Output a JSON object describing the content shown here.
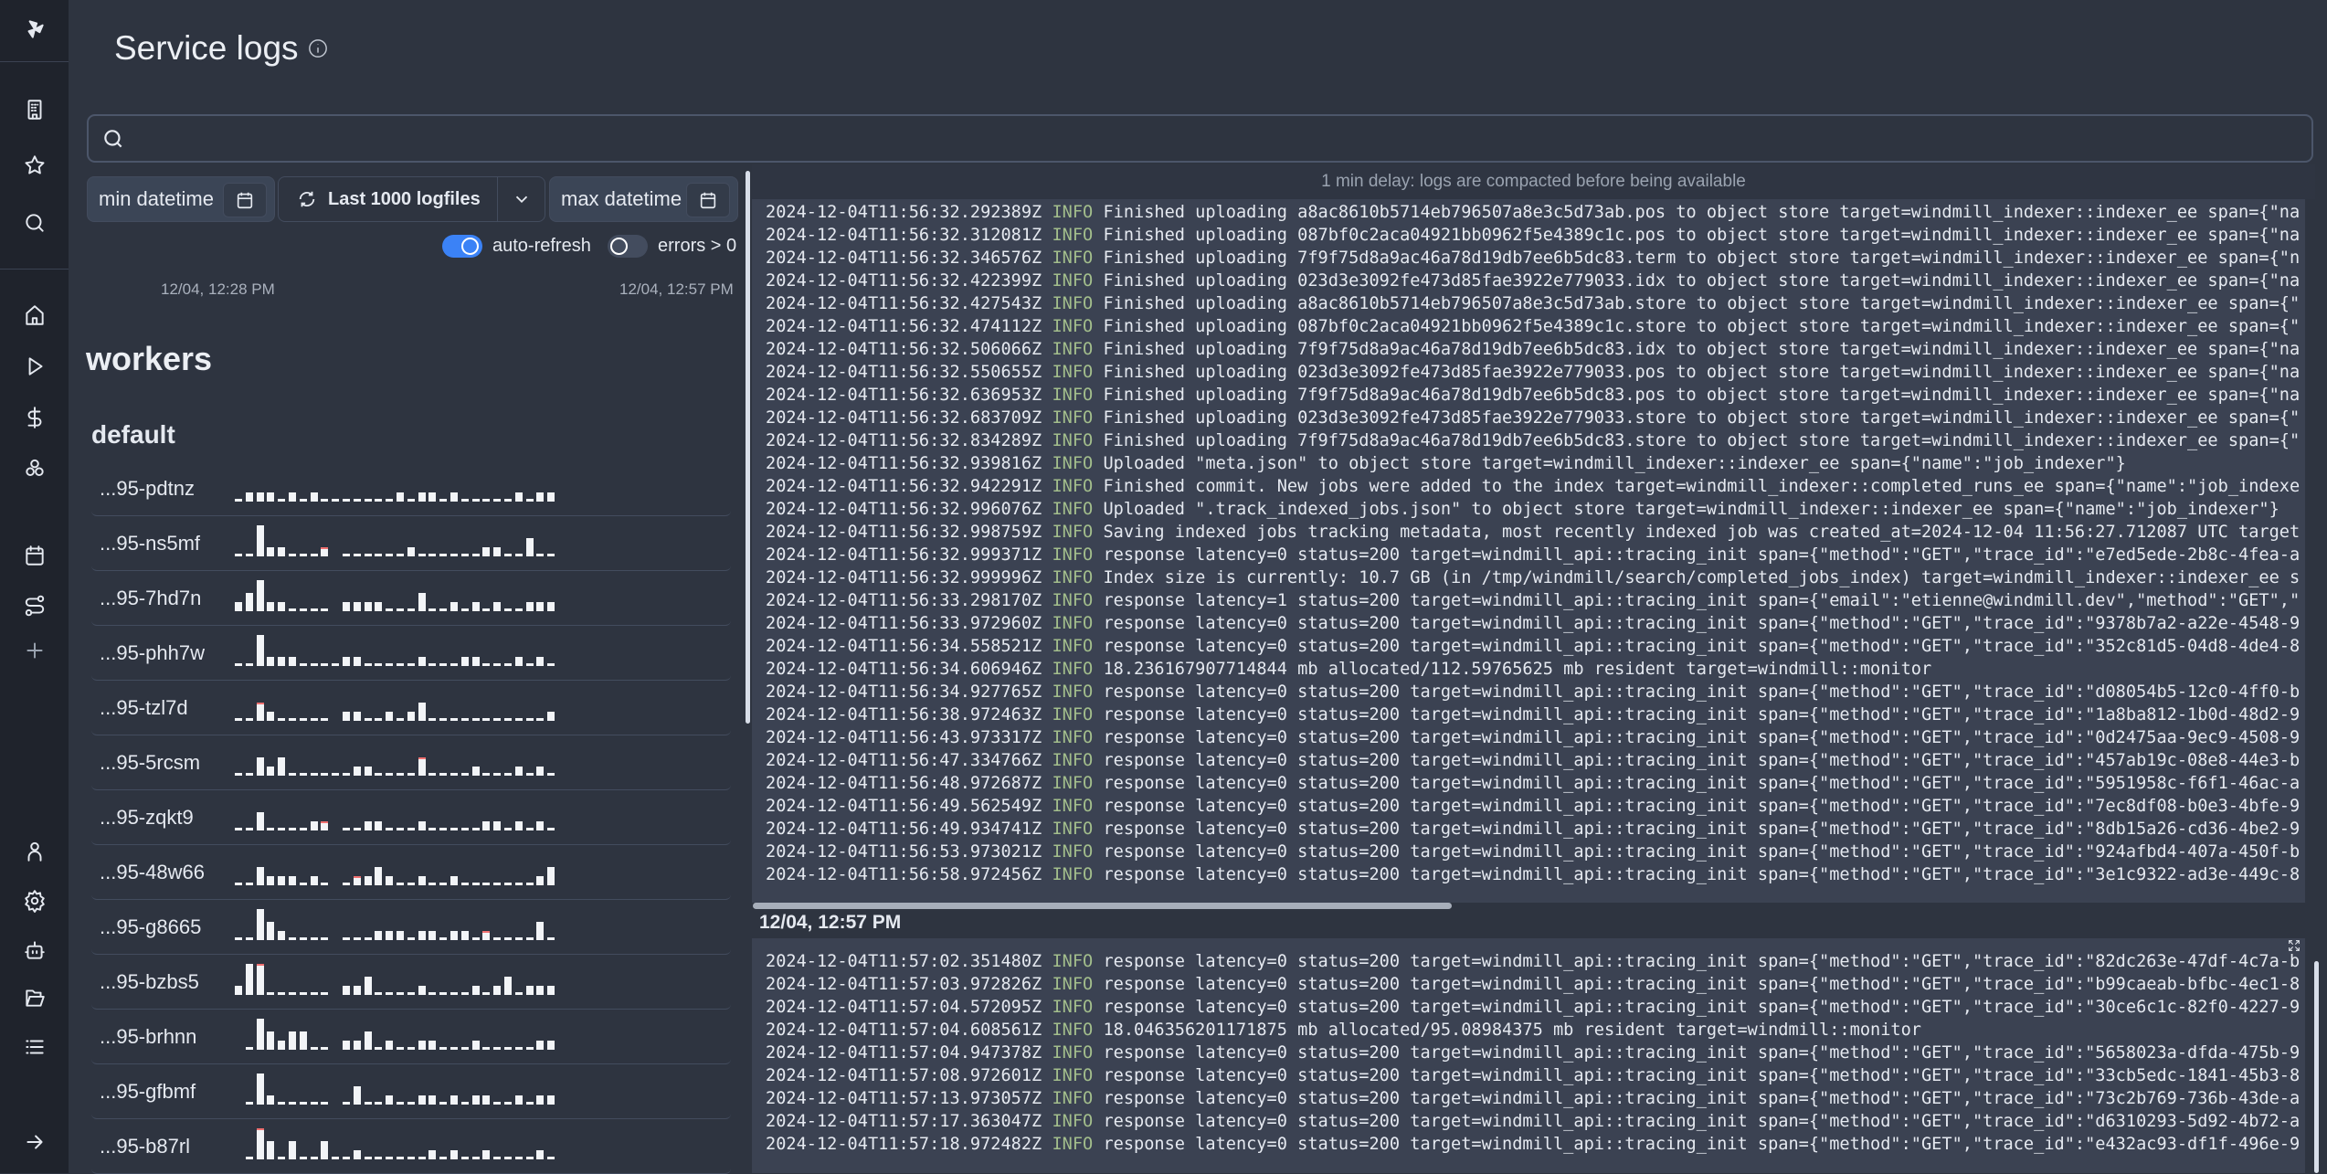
{
  "page": {
    "title": "Service logs",
    "info_icon": "info-icon"
  },
  "sidebar": {
    "items": [
      {
        "name": "logo",
        "icon": "windmill-logo"
      },
      {
        "name": "workspace",
        "icon": "building-icon"
      },
      {
        "name": "favorites",
        "icon": "star-icon"
      },
      {
        "name": "search",
        "icon": "search-icon"
      },
      {
        "name": "home",
        "icon": "home-icon"
      },
      {
        "name": "runs",
        "icon": "play-icon"
      },
      {
        "name": "variables",
        "icon": "dollar-icon"
      },
      {
        "name": "resources",
        "icon": "boxes-icon"
      },
      {
        "name": "schedules",
        "icon": "calendar-icon"
      },
      {
        "name": "flows",
        "icon": "route-icon"
      },
      {
        "name": "add",
        "icon": "plus-icon"
      },
      {
        "name": "user",
        "icon": "user-icon"
      },
      {
        "name": "settings",
        "icon": "gear-icon"
      },
      {
        "name": "workers",
        "icon": "bot-icon"
      },
      {
        "name": "folders",
        "icon": "folder-open-icon"
      },
      {
        "name": "logs",
        "icon": "list-icon"
      },
      {
        "name": "expand",
        "icon": "arrow-right-icon"
      }
    ]
  },
  "search": {
    "value": "",
    "placeholder": ""
  },
  "filters": {
    "min_datetime": "min datetime",
    "logfiles": "Last 1000 logfiles",
    "max_datetime": "max datetime",
    "auto_refresh": {
      "label": "auto-refresh",
      "on": true
    },
    "errors": {
      "label": "errors > 0",
      "on": false
    }
  },
  "timeline": {
    "start": "12/04, 12:28 PM",
    "end": "12/04, 12:57 PM"
  },
  "workers": {
    "heading": "workers",
    "group": "default",
    "items": [
      {
        "name": "...95-pdtnz",
        "bars": [
          0,
          1,
          1,
          1,
          0,
          1,
          0,
          1,
          0,
          0,
          0,
          0,
          0,
          0,
          0,
          1,
          0,
          1,
          1,
          0,
          1,
          0,
          0,
          0,
          0,
          0,
          1,
          0,
          1,
          1
        ],
        "errors": []
      },
      {
        "name": "...95-ns5mf",
        "bars": [
          0,
          0,
          3,
          1,
          1,
          0,
          0,
          0,
          1,
          null,
          0,
          0,
          0,
          0,
          0,
          0,
          1,
          0,
          0,
          0,
          0,
          0,
          0,
          1,
          1,
          0,
          0,
          2,
          0,
          0
        ],
        "errors": [
          8
        ]
      },
      {
        "name": "...95-7hd7n",
        "bars": [
          1,
          2,
          3,
          1,
          1,
          0,
          0,
          0,
          0,
          null,
          1,
          1,
          1,
          1,
          0,
          0,
          0,
          2,
          0,
          0,
          1,
          0,
          1,
          0,
          1,
          0,
          0,
          1,
          1,
          1
        ],
        "errors": []
      },
      {
        "name": "...95-phh7w",
        "bars": [
          0,
          0,
          3,
          1,
          1,
          1,
          0,
          0,
          0,
          0,
          1,
          1,
          0,
          0,
          0,
          0,
          0,
          1,
          0,
          0,
          0,
          1,
          1,
          0,
          0,
          0,
          1,
          0,
          1,
          0
        ],
        "errors": []
      },
      {
        "name": "...95-tzl7d",
        "bars": [
          0,
          0,
          2,
          1,
          0,
          0,
          0,
          0,
          0,
          null,
          1,
          1,
          0,
          0,
          1,
          0,
          1,
          2,
          0,
          0,
          0,
          0,
          0,
          0,
          0,
          0,
          0,
          0,
          0,
          1
        ],
        "errors": [
          2
        ]
      },
      {
        "name": "...95-5rcsm",
        "bars": [
          0,
          0,
          2,
          1,
          2,
          0,
          0,
          0,
          0,
          0,
          0,
          1,
          1,
          0,
          0,
          0,
          0,
          2,
          0,
          0,
          0,
          0,
          1,
          0,
          0,
          0,
          1,
          0,
          1,
          0
        ],
        "errors": [
          17
        ]
      },
      {
        "name": "...95-zqkt9",
        "bars": [
          0,
          0,
          2,
          0,
          0,
          0,
          0,
          1,
          1,
          null,
          0,
          0,
          1,
          1,
          0,
          0,
          0,
          1,
          0,
          0,
          0,
          0,
          0,
          1,
          1,
          0,
          1,
          0,
          1,
          0
        ],
        "errors": [
          8
        ]
      },
      {
        "name": "...95-48w66",
        "bars": [
          0,
          0,
          2,
          1,
          1,
          1,
          0,
          1,
          0,
          null,
          0,
          1,
          1,
          2,
          1,
          0,
          0,
          1,
          0,
          0,
          1,
          0,
          0,
          0,
          0,
          0,
          0,
          0,
          1,
          2
        ],
        "errors": [
          11
        ]
      },
      {
        "name": "...95-g8665",
        "bars": [
          0,
          0,
          3,
          2,
          1,
          0,
          0,
          0,
          0,
          null,
          0,
          0,
          0,
          1,
          1,
          1,
          0,
          1,
          1,
          0,
          1,
          1,
          0,
          1,
          0,
          0,
          0,
          0,
          2,
          0
        ],
        "errors": [
          23
        ]
      },
      {
        "name": "...95-bzbs5",
        "bars": [
          1,
          3,
          3,
          0,
          0,
          0,
          0,
          0,
          0,
          null,
          1,
          1,
          2,
          0,
          0,
          0,
          0,
          1,
          0,
          0,
          0,
          0,
          1,
          0,
          1,
          2,
          0,
          1,
          1,
          1
        ],
        "errors": [
          2
        ]
      },
      {
        "name": "...95-brhnn",
        "bars": [
          null,
          0,
          3,
          2,
          1,
          2,
          2,
          0,
          0,
          null,
          1,
          1,
          2,
          0,
          1,
          0,
          0,
          1,
          1,
          0,
          0,
          0,
          1,
          0,
          0,
          0,
          0,
          0,
          1,
          1
        ],
        "errors": []
      },
      {
        "name": "...95-gfbmf",
        "bars": [
          null,
          0,
          3,
          1,
          0,
          0,
          0,
          0,
          0,
          null,
          0,
          2,
          0,
          0,
          1,
          0,
          0,
          1,
          1,
          0,
          1,
          0,
          1,
          1,
          0,
          0,
          1,
          0,
          1,
          1
        ],
        "errors": []
      },
      {
        "name": "...95-b87rl",
        "bars": [
          null,
          0,
          3,
          2,
          0,
          2,
          0,
          0,
          2,
          0,
          0,
          1,
          0,
          0,
          0,
          0,
          0,
          0,
          1,
          0,
          1,
          0,
          0,
          1,
          0,
          0,
          0,
          0,
          1,
          0
        ],
        "errors": [
          2
        ]
      }
    ]
  },
  "logs": {
    "notice": "1 min delay: logs are compacted before being available",
    "upper": [
      {
        "ts": "2024-12-04T11:56:32.292389Z",
        "level": "INFO",
        "msg": "Finished uploading a8ac8610b5714eb796507a8e3c5d73ab.pos to object store target=windmill_indexer::indexer_ee span={\"na"
      },
      {
        "ts": "2024-12-04T11:56:32.312081Z",
        "level": "INFO",
        "msg": "Finished uploading 087bf0c2aca04921bb0962f5e4389c1c.pos to object store target=windmill_indexer::indexer_ee span={\"na"
      },
      {
        "ts": "2024-12-04T11:56:32.346576Z",
        "level": "INFO",
        "msg": "Finished uploading 7f9f75d8a9ac46a78d19db7ee6b5dc83.term to object store target=windmill_indexer::indexer_ee span={\"n"
      },
      {
        "ts": "2024-12-04T11:56:32.422399Z",
        "level": "INFO",
        "msg": "Finished uploading 023d3e3092fe473d85fae3922e779033.idx to object store target=windmill_indexer::indexer_ee span={\"na"
      },
      {
        "ts": "2024-12-04T11:56:32.427543Z",
        "level": "INFO",
        "msg": "Finished uploading a8ac8610b5714eb796507a8e3c5d73ab.store to object store target=windmill_indexer::indexer_ee span={\""
      },
      {
        "ts": "2024-12-04T11:56:32.474112Z",
        "level": "INFO",
        "msg": "Finished uploading 087bf0c2aca04921bb0962f5e4389c1c.store to object store target=windmill_indexer::indexer_ee span={\""
      },
      {
        "ts": "2024-12-04T11:56:32.506066Z",
        "level": "INFO",
        "msg": "Finished uploading 7f9f75d8a9ac46a78d19db7ee6b5dc83.idx to object store target=windmill_indexer::indexer_ee span={\"na"
      },
      {
        "ts": "2024-12-04T11:56:32.550655Z",
        "level": "INFO",
        "msg": "Finished uploading 023d3e3092fe473d85fae3922e779033.pos to object store target=windmill_indexer::indexer_ee span={\"na"
      },
      {
        "ts": "2024-12-04T11:56:32.636953Z",
        "level": "INFO",
        "msg": "Finished uploading 7f9f75d8a9ac46a78d19db7ee6b5dc83.pos to object store target=windmill_indexer::indexer_ee span={\"na"
      },
      {
        "ts": "2024-12-04T11:56:32.683709Z",
        "level": "INFO",
        "msg": "Finished uploading 023d3e3092fe473d85fae3922e779033.store to object store target=windmill_indexer::indexer_ee span={\""
      },
      {
        "ts": "2024-12-04T11:56:32.834289Z",
        "level": "INFO",
        "msg": "Finished uploading 7f9f75d8a9ac46a78d19db7ee6b5dc83.store to object store target=windmill_indexer::indexer_ee span={\""
      },
      {
        "ts": "2024-12-04T11:56:32.939816Z",
        "level": "INFO",
        "msg": "Uploaded \"meta.json\" to object store target=windmill_indexer::indexer_ee span={\"name\":\"job_indexer\"}"
      },
      {
        "ts": "2024-12-04T11:56:32.942291Z",
        "level": "INFO",
        "msg": "Finished commit. New jobs were added to the index target=windmill_indexer::completed_runs_ee span={\"name\":\"job_indexe"
      },
      {
        "ts": "2024-12-04T11:56:32.996076Z",
        "level": "INFO",
        "msg": "Uploaded \".track_indexed_jobs.json\" to object store target=windmill_indexer::indexer_ee span={\"name\":\"job_indexer\"}"
      },
      {
        "ts": "2024-12-04T11:56:32.998759Z",
        "level": "INFO",
        "msg": "Saving indexed jobs tracking metadata, most recently indexed job was created_at=2024-12-04 11:56:27.712087 UTC target"
      },
      {
        "ts": "2024-12-04T11:56:32.999371Z",
        "level": "INFO",
        "msg": "response latency=0 status=200 target=windmill_api::tracing_init span={\"method\":\"GET\",\"trace_id\":\"e7ed5ede-2b8c-4fea-a"
      },
      {
        "ts": "2024-12-04T11:56:32.999996Z",
        "level": "INFO",
        "msg": "Index size is currently: 10.7 GB (in /tmp/windmill/search/completed_jobs_index) target=windmill_indexer::indexer_ee s"
      },
      {
        "ts": "2024-12-04T11:56:33.298170Z",
        "level": "INFO",
        "msg": "response latency=1 status=200 target=windmill_api::tracing_init span={\"email\":\"etienne@windmill.dev\",\"method\":\"GET\",\""
      },
      {
        "ts": "2024-12-04T11:56:33.972960Z",
        "level": "INFO",
        "msg": "response latency=0 status=200 target=windmill_api::tracing_init span={\"method\":\"GET\",\"trace_id\":\"9378b7a2-a22e-4548-9"
      },
      {
        "ts": "2024-12-04T11:56:34.558521Z",
        "level": "INFO",
        "msg": "response latency=0 status=200 target=windmill_api::tracing_init span={\"method\":\"GET\",\"trace_id\":\"352c81d5-04d8-4de4-8"
      },
      {
        "ts": "2024-12-04T11:56:34.606946Z",
        "level": "INFO",
        "msg": "18.236167907714844 mb allocated/112.59765625 mb resident target=windmill::monitor"
      },
      {
        "ts": "2024-12-04T11:56:34.927765Z",
        "level": "INFO",
        "msg": "response latency=0 status=200 target=windmill_api::tracing_init span={\"method\":\"GET\",\"trace_id\":\"d08054b5-12c0-4ff0-b"
      },
      {
        "ts": "2024-12-04T11:56:38.972463Z",
        "level": "INFO",
        "msg": "response latency=0 status=200 target=windmill_api::tracing_init span={\"method\":\"GET\",\"trace_id\":\"1a8ba812-1b0d-48d2-9"
      },
      {
        "ts": "2024-12-04T11:56:43.973317Z",
        "level": "INFO",
        "msg": "response latency=0 status=200 target=windmill_api::tracing_init span={\"method\":\"GET\",\"trace_id\":\"0d2475aa-9ec9-4508-9"
      },
      {
        "ts": "2024-12-04T11:56:47.334766Z",
        "level": "INFO",
        "msg": "response latency=0 status=200 target=windmill_api::tracing_init span={\"method\":\"GET\",\"trace_id\":\"457ab19c-08e8-44e3-b"
      },
      {
        "ts": "2024-12-04T11:56:48.972687Z",
        "level": "INFO",
        "msg": "response latency=0 status=200 target=windmill_api::tracing_init span={\"method\":\"GET\",\"trace_id\":\"5951958c-f6f1-46ac-a"
      },
      {
        "ts": "2024-12-04T11:56:49.562549Z",
        "level": "INFO",
        "msg": "response latency=0 status=200 target=windmill_api::tracing_init span={\"method\":\"GET\",\"trace_id\":\"7ec8df08-b0e3-4bfe-9"
      },
      {
        "ts": "2024-12-04T11:56:49.934741Z",
        "level": "INFO",
        "msg": "response latency=0 status=200 target=windmill_api::tracing_init span={\"method\":\"GET\",\"trace_id\":\"8db15a26-cd36-4be2-9"
      },
      {
        "ts": "2024-12-04T11:56:53.973021Z",
        "level": "INFO",
        "msg": "response latency=0 status=200 target=windmill_api::tracing_init span={\"method\":\"GET\",\"trace_id\":\"924afbd4-407a-450f-b"
      },
      {
        "ts": "2024-12-04T11:56:58.972456Z",
        "level": "INFO",
        "msg": "response latency=0 status=200 target=windmill_api::tracing_init span={\"method\":\"GET\",\"trace_id\":\"3e1c9322-ad3e-449c-8"
      }
    ],
    "section_header": "12/04, 12:57 PM",
    "lower": [
      {
        "ts": "2024-12-04T11:57:02.351480Z",
        "level": "INFO",
        "msg": "response latency=0 status=200 target=windmill_api::tracing_init span={\"method\":\"GET\",\"trace_id\":\"82dc263e-47df-4c7a-b"
      },
      {
        "ts": "2024-12-04T11:57:03.972826Z",
        "level": "INFO",
        "msg": "response latency=0 status=200 target=windmill_api::tracing_init span={\"method\":\"GET\",\"trace_id\":\"b99caeab-bfbc-4ec1-8"
      },
      {
        "ts": "2024-12-04T11:57:04.572095Z",
        "level": "INFO",
        "msg": "response latency=0 status=200 target=windmill_api::tracing_init span={\"method\":\"GET\",\"trace_id\":\"30ce6c1c-82f0-4227-9"
      },
      {
        "ts": "2024-12-04T11:57:04.608561Z",
        "level": "INFO",
        "msg": "18.046356201171875 mb allocated/95.08984375 mb resident target=windmill::monitor"
      },
      {
        "ts": "2024-12-04T11:57:04.947378Z",
        "level": "INFO",
        "msg": "response latency=0 status=200 target=windmill_api::tracing_init span={\"method\":\"GET\",\"trace_id\":\"5658023a-dfda-475b-9"
      },
      {
        "ts": "2024-12-04T11:57:08.972601Z",
        "level": "INFO",
        "msg": "response latency=0 status=200 target=windmill_api::tracing_init span={\"method\":\"GET\",\"trace_id\":\"33cb5edc-1841-45b3-8"
      },
      {
        "ts": "2024-12-04T11:57:13.973057Z",
        "level": "INFO",
        "msg": "response latency=0 status=200 target=windmill_api::tracing_init span={\"method\":\"GET\",\"trace_id\":\"73c2b769-736b-43de-a"
      },
      {
        "ts": "2024-12-04T11:57:17.363047Z",
        "level": "INFO",
        "msg": "response latency=0 status=200 target=windmill_api::tracing_init span={\"method\":\"GET\",\"trace_id\":\"d6310293-5d92-4b72-a"
      },
      {
        "ts": "2024-12-04T11:57:18.972482Z",
        "level": "INFO",
        "msg": "response latency=0 status=200 target=windmill_api::tracing_init span={\"method\":\"GET\",\"trace_id\":\"e432ac93-df1f-496e-9"
      }
    ]
  },
  "colors": {
    "accent": "#3b82f6",
    "info": "#a3be8c",
    "error": "#f07070",
    "background": "#2e3440",
    "log_background": "#3b4252"
  }
}
